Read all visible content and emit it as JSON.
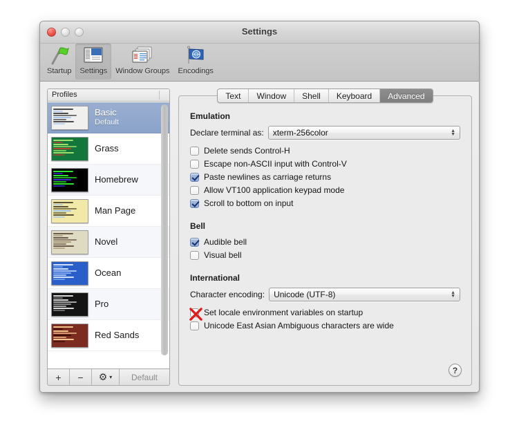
{
  "window": {
    "title": "Settings",
    "traffic_lights": [
      "close",
      "minimize",
      "maximize"
    ]
  },
  "toolbar": {
    "items": [
      {
        "label": "Startup",
        "icon": "flag-icon",
        "selected": false
      },
      {
        "label": "Settings",
        "icon": "settings-window-icon",
        "selected": true
      },
      {
        "label": "Window Groups",
        "icon": "window-groups-icon",
        "selected": false
      },
      {
        "label": "Encodings",
        "icon": "un-flag-icon",
        "selected": false
      }
    ]
  },
  "profiles": {
    "header": "Profiles",
    "items": [
      {
        "name": "Basic",
        "sub": "Default",
        "selected": true,
        "thumb": {
          "bg": "#f0f0ee",
          "fg": "#4a4a4a",
          "accent": "#a9c6e8"
        }
      },
      {
        "name": "Grass",
        "sub": "",
        "selected": false,
        "thumb": {
          "bg": "#13773d",
          "fg": "#9ee06a",
          "accent": "#b5442f"
        }
      },
      {
        "name": "Homebrew",
        "sub": "",
        "selected": false,
        "thumb": {
          "bg": "#000000",
          "fg": "#2ee62e",
          "accent": "#3b2fd8"
        }
      },
      {
        "name": "Man Page",
        "sub": "",
        "selected": false,
        "thumb": {
          "bg": "#f2e9a8",
          "fg": "#5c5236",
          "accent": "#9fc3e6"
        }
      },
      {
        "name": "Novel",
        "sub": "",
        "selected": false,
        "thumb": {
          "bg": "#dfdbc3",
          "fg": "#6b5a47",
          "accent": "#a89878"
        }
      },
      {
        "name": "Ocean",
        "sub": "",
        "selected": false,
        "thumb": {
          "bg": "#2a5fc9",
          "fg": "#cfe0ff",
          "accent": "#7fa8ef"
        }
      },
      {
        "name": "Pro",
        "sub": "",
        "selected": false,
        "thumb": {
          "bg": "#141414",
          "fg": "#d8d8d8",
          "accent": "#8a8a8a"
        }
      },
      {
        "name": "Red Sands",
        "sub": "",
        "selected": false,
        "thumb": {
          "bg": "#7c2b20",
          "fg": "#f0c18a",
          "accent": "#3a1009"
        }
      }
    ],
    "toolbar": {
      "add": "+",
      "remove": "−",
      "gear": "⚙",
      "gear_arrow": "▾",
      "default": "Default"
    }
  },
  "tabs": [
    {
      "label": "Text",
      "active": false
    },
    {
      "label": "Window",
      "active": false
    },
    {
      "label": "Shell",
      "active": false
    },
    {
      "label": "Keyboard",
      "active": false
    },
    {
      "label": "Advanced",
      "active": true
    }
  ],
  "advanced": {
    "emulation": {
      "title": "Emulation",
      "declare_label": "Declare terminal as:",
      "declare_value": "xterm-256color",
      "checkboxes": [
        {
          "label": "Delete sends Control-H",
          "checked": false
        },
        {
          "label": "Escape non-ASCII input with Control-V",
          "checked": false
        },
        {
          "label": "Paste newlines as carriage returns",
          "checked": true
        },
        {
          "label": "Allow VT100 application keypad mode",
          "checked": false
        },
        {
          "label": "Scroll to bottom on input",
          "checked": true
        }
      ]
    },
    "bell": {
      "title": "Bell",
      "checkboxes": [
        {
          "label": "Audible bell",
          "checked": true
        },
        {
          "label": "Visual bell",
          "checked": false
        }
      ]
    },
    "international": {
      "title": "International",
      "encoding_label": "Character encoding:",
      "encoding_value": "Unicode (UTF-8)",
      "checkboxes": [
        {
          "label": "Set locale environment variables on startup",
          "checked": false,
          "annotation": "red-x"
        },
        {
          "label": "Unicode East Asian Ambiguous characters are wide",
          "checked": false
        }
      ]
    },
    "help": "?"
  },
  "colors": {
    "selection_blue": "#8ba3ca",
    "active_tab": "#7e7e7e",
    "annotation_red": "#e01b1b"
  }
}
